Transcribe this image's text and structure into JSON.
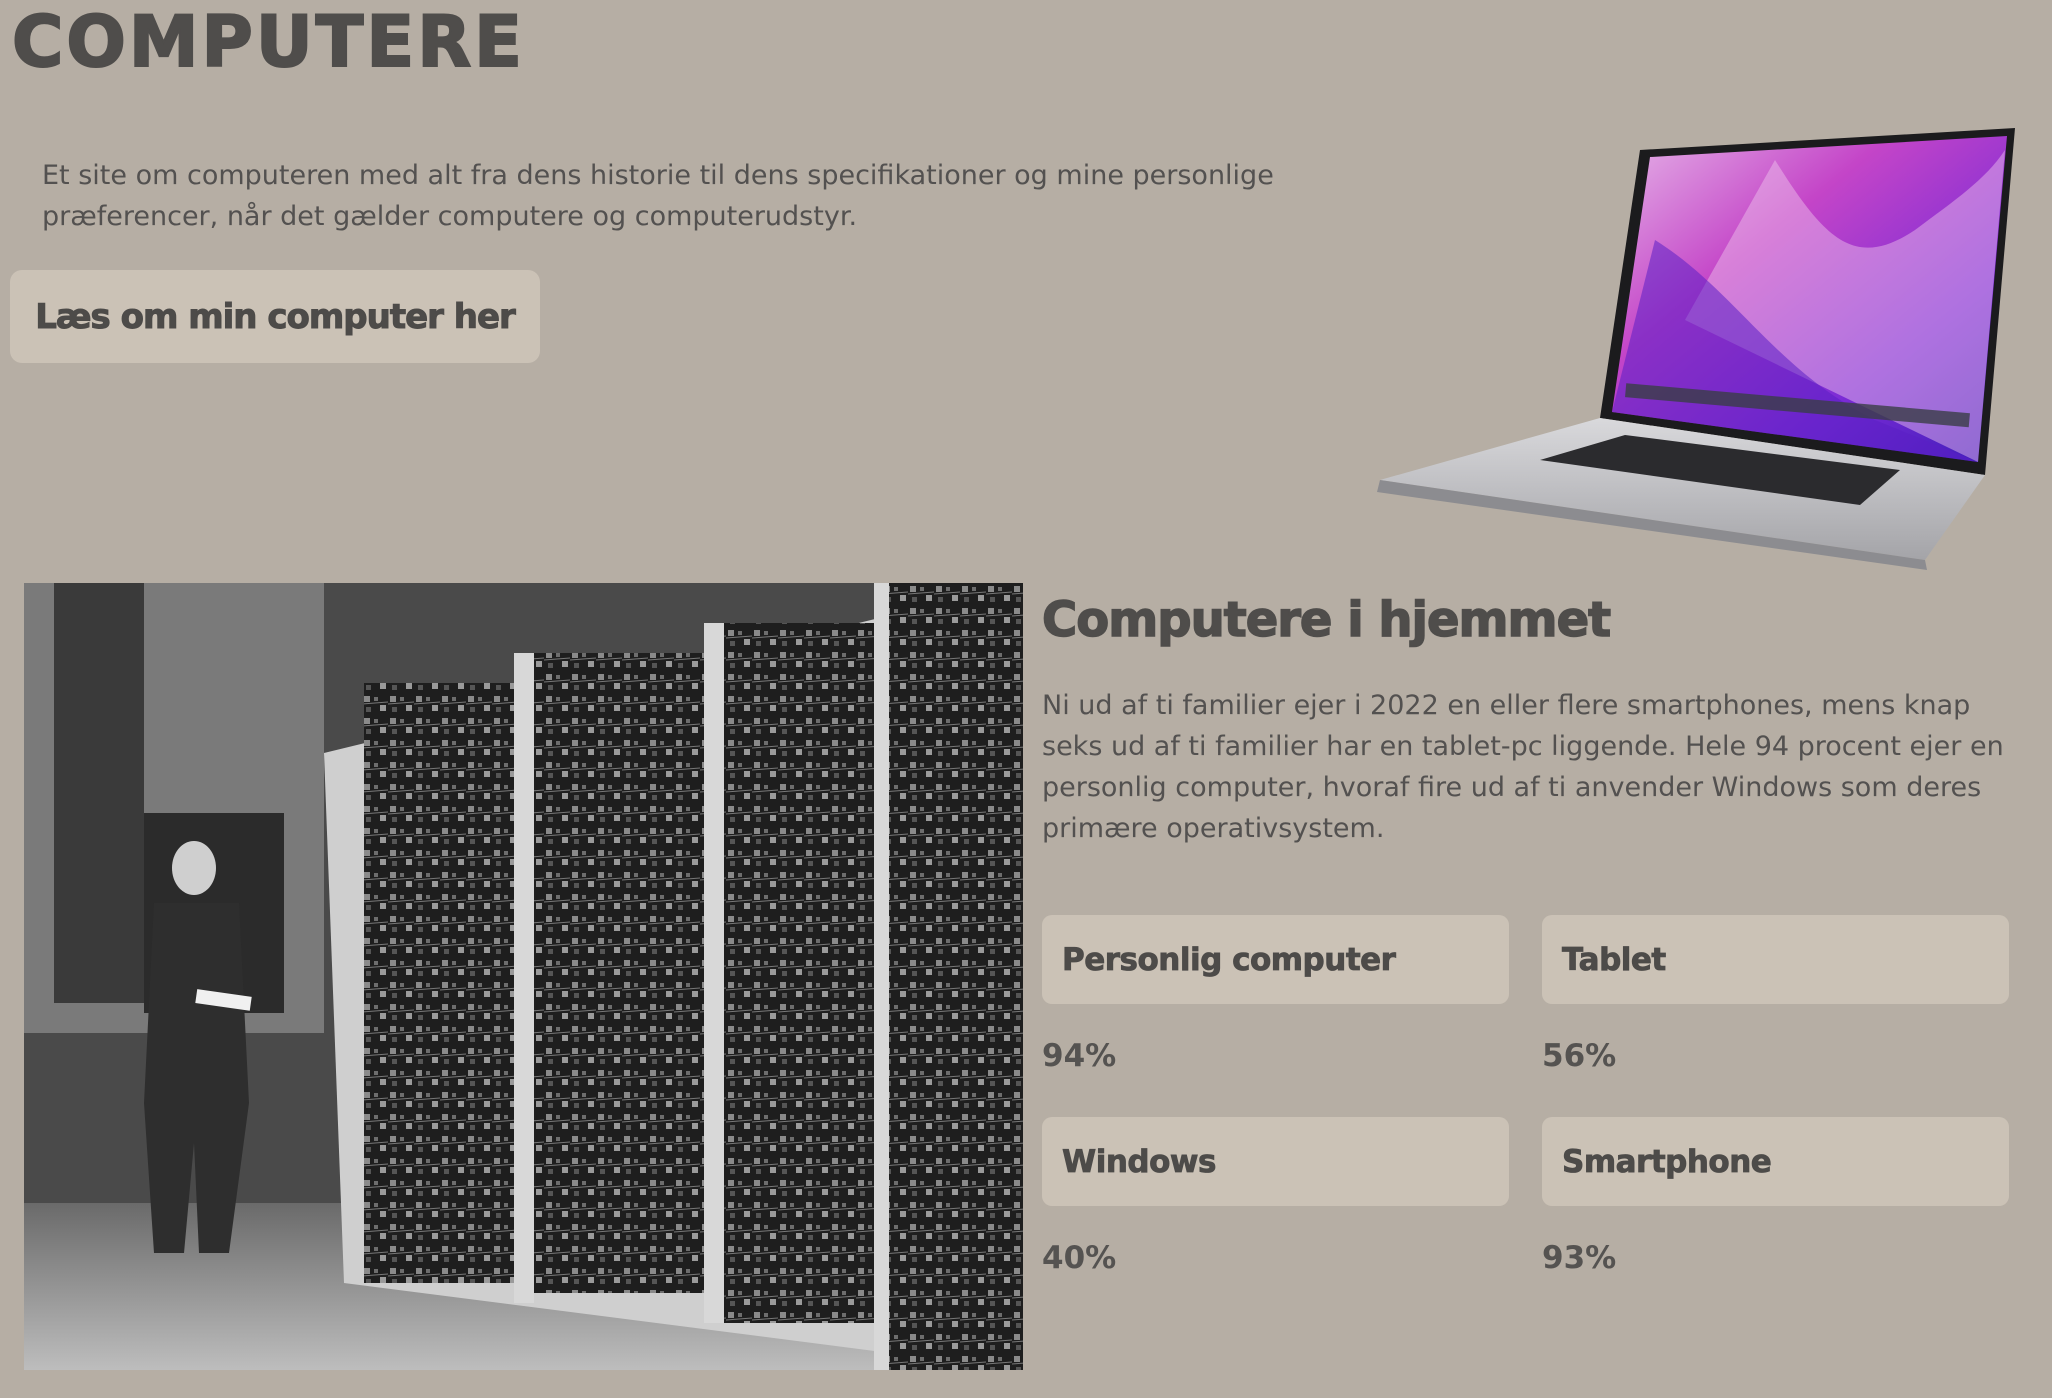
{
  "site": {
    "title": "COMPUTERE",
    "intro": "Et site om computeren med alt fra dens historie til dens specifikationer og mine personlige præferencer, når det gælder computere og computerudstyr.",
    "cta_label": "Læs om min computer her"
  },
  "images": {
    "laptop": "laptop-image",
    "mainframe": "mainframe-photo"
  },
  "section": {
    "heading": "Computere i hjemmet",
    "text": "Ni ud af ti familier ejer i 2022 en eller flere smartphones, mens knap seks ud af ti familier har en tablet-pc liggende. Hele 94 procent ejer en personlig computer, hvoraf fire ud af ti anvender Windows som deres primære operativsystem."
  },
  "stats": [
    {
      "label": "Personlig computer",
      "value": "94%"
    },
    {
      "label": "Tablet",
      "value": "56%"
    },
    {
      "label": "Windows",
      "value": "40%"
    },
    {
      "label": "Smartphone",
      "value": "93%"
    }
  ],
  "colors": {
    "background": "#b6aea4",
    "card": "#cbc2b6",
    "text": "#4d4b49"
  }
}
